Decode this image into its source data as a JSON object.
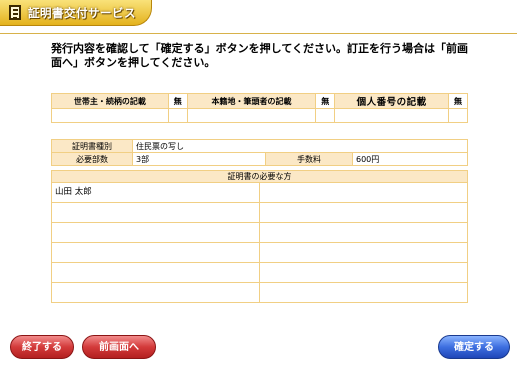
{
  "header": {
    "title": "証明書交付サービス",
    "icon": "document-icon"
  },
  "instruction": "発行内容を確認して「確定する」ボタンを押してください。訂正を行う場合は「前画面へ」ボタンを押してください。",
  "options": [
    {
      "label": "世帯主・続柄の記載",
      "value": "無"
    },
    {
      "label": "本籍地・筆頭者の記載",
      "value": "無"
    },
    {
      "label": "個人番号の記載",
      "value": "無"
    }
  ],
  "details": {
    "cert_type_label": "証明書種別",
    "cert_type_value": "住民票の写し",
    "copies_label": "必要部数",
    "copies_value": "3部",
    "fee_label": "手数料",
    "fee_value": "600円"
  },
  "persons": {
    "header": "証明書の必要な方",
    "rows": [
      [
        "山田 太郎",
        ""
      ],
      [
        "",
        ""
      ],
      [
        "",
        ""
      ],
      [
        "",
        ""
      ],
      [
        "",
        ""
      ],
      [
        "",
        ""
      ]
    ]
  },
  "buttons": {
    "quit": "終了する",
    "back": "前画面へ",
    "confirm": "確定する"
  }
}
